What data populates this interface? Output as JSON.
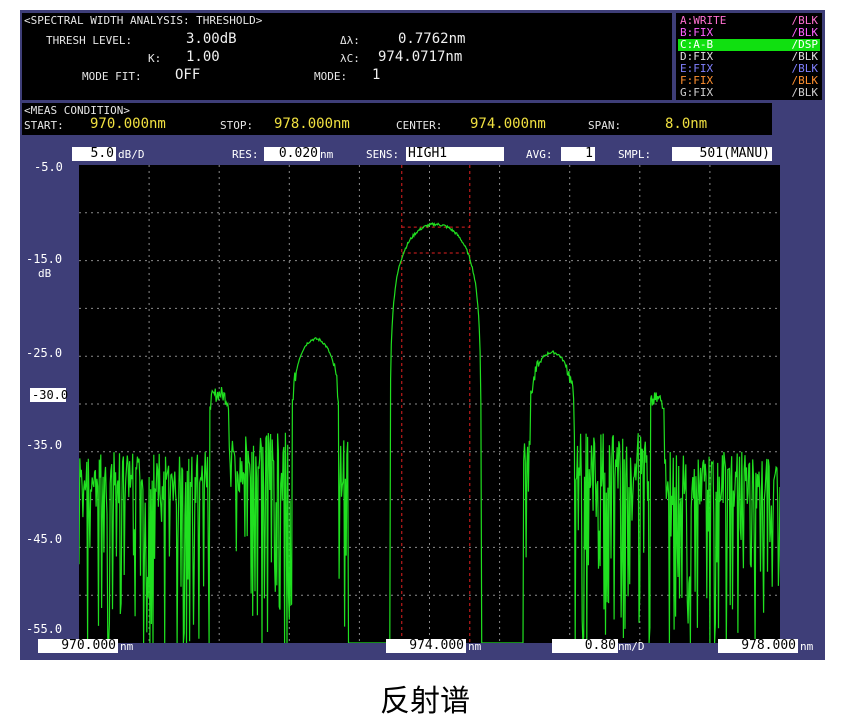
{
  "analysis": {
    "title": "<SPECTRAL WIDTH ANALYSIS: THRESHOLD>",
    "thresh_label": "THRESH LEVEL:",
    "thresh_value": "3.00dB",
    "k_label": "K:",
    "k_value": "1.00",
    "mode_fit_label": "MODE FIT:",
    "mode_fit_value": "OFF",
    "dl_label": "Δλ:",
    "dl_value": "0.7762nm",
    "lc_label": "λC:",
    "lc_value": "974.0717nm",
    "mode_label": "MODE:",
    "mode_value": "1"
  },
  "traces": [
    {
      "name": "A:WRITE",
      "state": "/BLK",
      "color": "#ff70d0"
    },
    {
      "name": "B:FIX",
      "state": "/BLK",
      "color": "#ff60ff"
    },
    {
      "name": "C:A-B",
      "state": "/DSP",
      "color": "#ffffff",
      "highlight": "#10e010"
    },
    {
      "name": "D:FIX",
      "state": "/BLK",
      "color": "#e0e0e0"
    },
    {
      "name": "E:FIX",
      "state": "/BLK",
      "color": "#8080ff"
    },
    {
      "name": "F:FIX",
      "state": "/BLK",
      "color": "#ff9030"
    },
    {
      "name": "G:FIX",
      "state": "/BLK",
      "color": "#d0d0d0"
    }
  ],
  "meas": {
    "title": "<MEAS CONDITION>",
    "start_label": "START:",
    "start_value": "970.000nm",
    "stop_label": "STOP:",
    "stop_value": "978.000nm",
    "center_label": "CENTER:",
    "center_value": "974.000nm",
    "span_label": "SPAN:",
    "span_value": "8.0nm"
  },
  "settings": {
    "scale_value": "5.0",
    "scale_unit": "dB/D",
    "res_label": "RES:",
    "res_value": "0.020",
    "res_unit": "nm",
    "sens_label": "SENS:",
    "sens_value": "HIGH1",
    "avg_label": "AVG:",
    "avg_value": "1",
    "smpl_label": "SMPL:",
    "smpl_value": "501(MANU)"
  },
  "y_axis": {
    "unit": "dB",
    "ref_level": "-30.0",
    "labels": [
      "-5.0",
      "-15.0",
      "-25.0",
      "-35.0",
      "-45.0",
      "-55.0"
    ]
  },
  "x_axis": {
    "start": "970.000",
    "start_unit": "nm",
    "center": "974.000",
    "center_unit": "nm",
    "per_div": "0.80",
    "per_div_unit": "nm/D",
    "stop": "978.000",
    "stop_unit": "nm"
  },
  "colors": {
    "trace": "#20e020",
    "grid": "#8a8a8a",
    "marker": "#e02020"
  },
  "caption": "反射谱"
}
